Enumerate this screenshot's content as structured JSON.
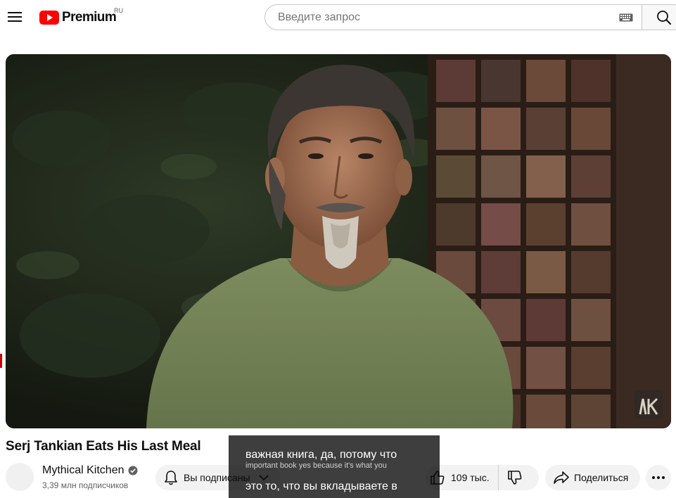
{
  "header": {
    "logo_text": "Premium",
    "region": "RU",
    "search_placeholder": "Введите запрос"
  },
  "video": {
    "title": "Serj Tankian Eats His Last Meal"
  },
  "channel": {
    "name": "Mythical Kitchen",
    "subscribers": "3,39 млн подписчиков",
    "verified": true
  },
  "actions": {
    "subscribed_label": "Вы подписаны",
    "like_count": "109 тыс.",
    "share_label": "Поделиться"
  },
  "captions": {
    "line1": "важная книга, да, потому что",
    "line1_translation": "important book yes because it's what you",
    "line2": "это то, что вы вкладываете в"
  },
  "colors": {
    "brand_red": "#ff0000",
    "pill_bg": "#f2f2f2"
  }
}
